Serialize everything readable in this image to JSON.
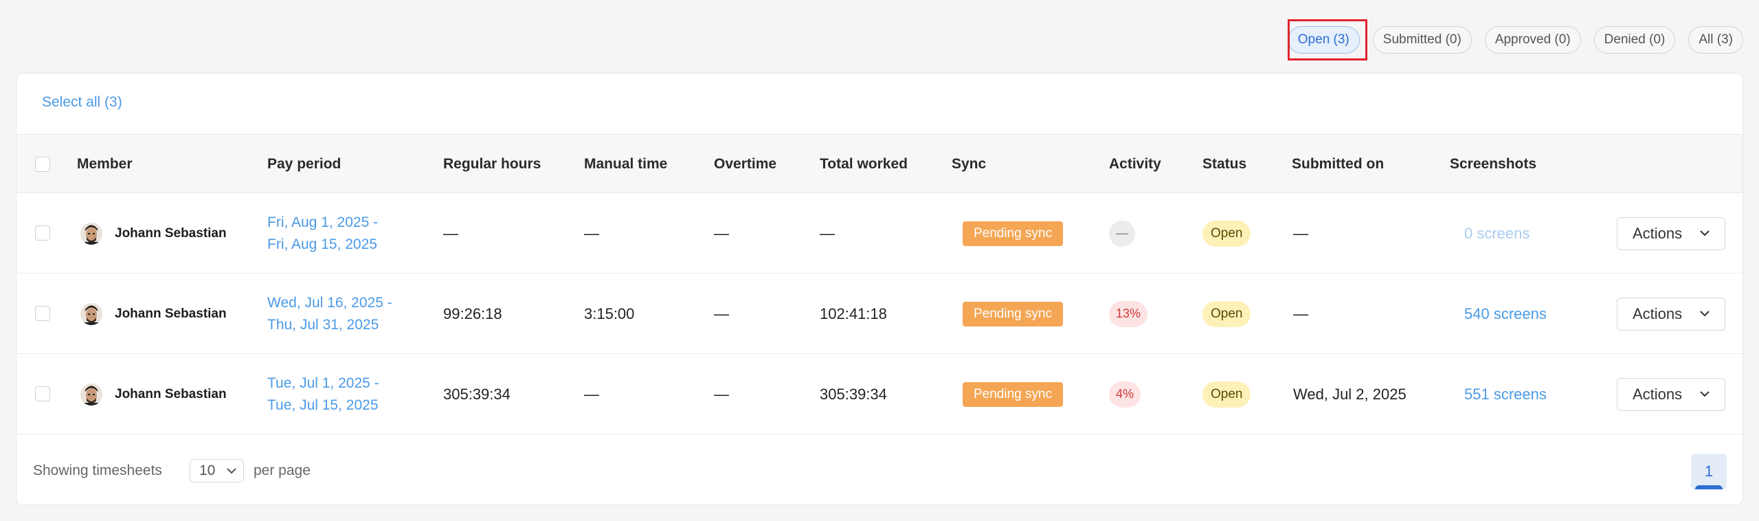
{
  "filters": [
    {
      "label": "Open (3)",
      "active": true
    },
    {
      "label": "Submitted (0)",
      "active": false
    },
    {
      "label": "Approved (0)",
      "active": false
    },
    {
      "label": "Denied (0)",
      "active": false
    },
    {
      "label": "All (3)",
      "active": false
    }
  ],
  "select_all": "Select all (3)",
  "columns": {
    "member": "Member",
    "pay_period": "Pay period",
    "regular_hours": "Regular hours",
    "manual_time": "Manual time",
    "overtime": "Overtime",
    "total_worked": "Total worked",
    "sync": "Sync",
    "activity": "Activity",
    "status": "Status",
    "submitted_on": "Submitted on",
    "screenshots": "Screenshots"
  },
  "rows": [
    {
      "member": "Johann Sebastian",
      "period_start": "Fri, Aug 1, 2025 -",
      "period_end": "Fri, Aug 15, 2025",
      "regular_hours": "—",
      "manual_time": "—",
      "overtime": "—",
      "total_worked": "—",
      "sync": "Pending sync",
      "activity": "—",
      "status": "Open",
      "submitted_on": "—",
      "screenshots": "0 screens",
      "actions": "Actions"
    },
    {
      "member": "Johann Sebastian",
      "period_start": "Wed, Jul 16, 2025 -",
      "period_end": "Thu, Jul 31, 2025",
      "regular_hours": "99:26:18",
      "manual_time": "3:15:00",
      "overtime": "—",
      "total_worked": "102:41:18",
      "sync": "Pending sync",
      "activity": "13%",
      "status": "Open",
      "submitted_on": "—",
      "screenshots": "540 screens",
      "actions": "Actions"
    },
    {
      "member": "Johann Sebastian",
      "period_start": "Tue, Jul 1, 2025 -",
      "period_end": "Tue, Jul 15, 2025",
      "regular_hours": "305:39:34",
      "manual_time": "—",
      "overtime": "—",
      "total_worked": "305:39:34",
      "sync": "Pending sync",
      "activity": "4%",
      "status": "Open",
      "submitted_on": "Wed, Jul 2, 2025",
      "screenshots": "551 screens",
      "actions": "Actions"
    }
  ],
  "footer": {
    "showing_label": "Showing timesheets",
    "per_page_value": "10",
    "per_page_label": "per page",
    "current_page": "1"
  },
  "colors": {
    "accent": "#4a9ae6",
    "sync_badge": "#f4a654",
    "status_open": "#fdf1b8",
    "activity_low": "#fde3e3",
    "highlight": "#e0232a"
  },
  "icons": {
    "dropdown": "chevron-down-icon",
    "avatar": "user-avatar"
  }
}
